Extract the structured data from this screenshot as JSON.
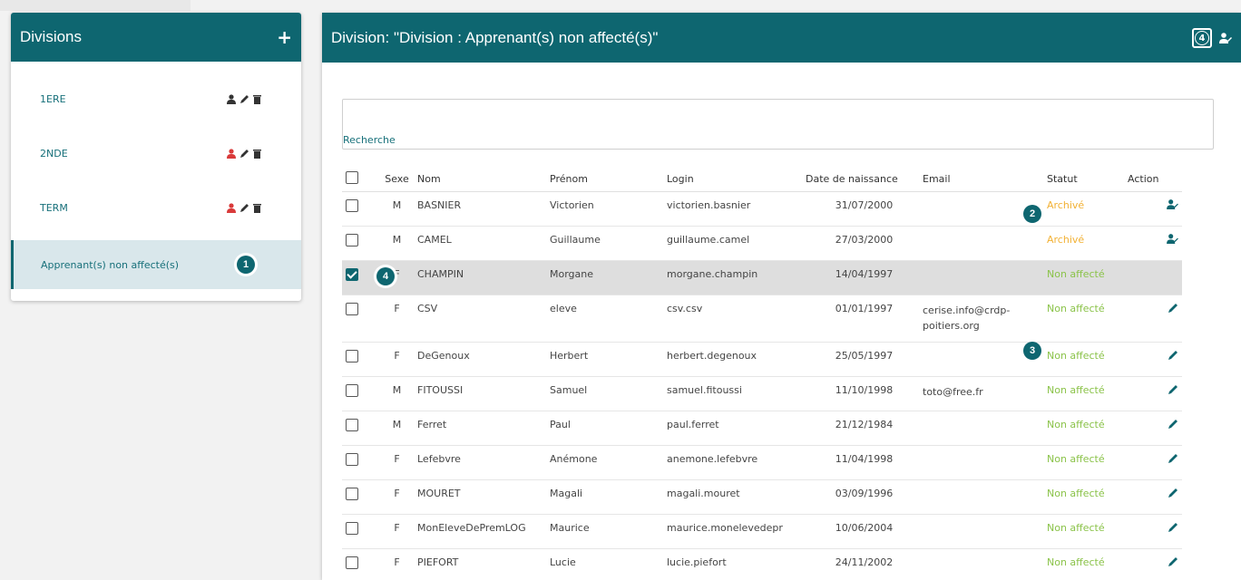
{
  "left": {
    "title": "Divisions",
    "add_label": "+",
    "items": [
      {
        "label": "1ERE",
        "user_color": "#333333"
      },
      {
        "label": "2NDE",
        "user_color": "#d93a3a"
      },
      {
        "label": "TERM",
        "user_color": "#d93a3a"
      },
      {
        "label": "Apprenant(s) non affecté(s)",
        "badge": "1"
      }
    ]
  },
  "right": {
    "title": "Division: \"Division : Apprenant(s) non affecté(s)\"",
    "header_badge": "4",
    "search_label": "Recherche",
    "search_value": "",
    "columns": [
      "Sexe",
      "Nom",
      "Prénom",
      "Login",
      "Date de naissance",
      "Email",
      "Statut",
      "Action"
    ],
    "rows": [
      {
        "sexe": "M",
        "nom": "BASNIER",
        "prenom": "Victorien",
        "login": "victorien.basnier",
        "date": "31/07/2000",
        "email": "",
        "statut": "Archivé",
        "action": "user",
        "checked": false
      },
      {
        "sexe": "M",
        "nom": "CAMEL",
        "prenom": "Guillaume",
        "login": "guillaume.camel",
        "date": "27/03/2000",
        "email": "",
        "statut": "Archivé",
        "action": "user",
        "checked": false
      },
      {
        "sexe": "F",
        "nom": "CHAMPIN",
        "prenom": "Morgane",
        "login": "morgane.champin",
        "date": "14/04/1997",
        "email": "",
        "statut": "Non affecté",
        "action": "",
        "checked": true
      },
      {
        "sexe": "F",
        "nom": "CSV",
        "prenom": "eleve",
        "login": "csv.csv",
        "date": "01/01/1997",
        "email": "cerise.info@crdp-poitiers.org",
        "statut": "Non affecté",
        "action": "edit",
        "checked": false
      },
      {
        "sexe": "F",
        "nom": "DeGenoux",
        "prenom": "Herbert",
        "login": "herbert.degenoux",
        "date": "25/05/1997",
        "email": "",
        "statut": "Non affecté",
        "action": "edit",
        "checked": false
      },
      {
        "sexe": "M",
        "nom": "FITOUSSI",
        "prenom": "Samuel",
        "login": "samuel.fitoussi",
        "date": "11/10/1998",
        "email": "toto@free.fr",
        "statut": "Non affecté",
        "action": "edit",
        "checked": false
      },
      {
        "sexe": "M",
        "nom": "Ferret",
        "prenom": "Paul",
        "login": "paul.ferret",
        "date": "21/12/1984",
        "email": "",
        "statut": "Non affecté",
        "action": "edit",
        "checked": false
      },
      {
        "sexe": "F",
        "nom": "Lefebvre",
        "prenom": "Anémone",
        "login": "anemone.lefebvre",
        "date": "11/04/1998",
        "email": "",
        "statut": "Non affecté",
        "action": "edit",
        "checked": false
      },
      {
        "sexe": "F",
        "nom": "MOURET",
        "prenom": "Magali",
        "login": "magali.mouret",
        "date": "03/09/1996",
        "email": "",
        "statut": "Non affecté",
        "action": "edit",
        "checked": false
      },
      {
        "sexe": "F",
        "nom": "MonEleveDePremLOG",
        "prenom": "Maurice",
        "login": "maurice.monelevedepr",
        "date": "10/06/2004",
        "email": "",
        "statut": "Non affecté",
        "action": "edit",
        "checked": false
      },
      {
        "sexe": "F",
        "nom": "PIEFORT",
        "prenom": "Lucie",
        "login": "lucie.piefort",
        "date": "24/11/2002",
        "email": "",
        "statut": "Non affecté",
        "action": "edit",
        "checked": false
      }
    ],
    "callouts": {
      "b2": "2",
      "b3": "3",
      "b4": "4"
    }
  },
  "colors": {
    "primary": "#0e6670",
    "archive": "#f2b134",
    "non_affecte": "#8bc34a",
    "danger": "#d93a3a"
  }
}
